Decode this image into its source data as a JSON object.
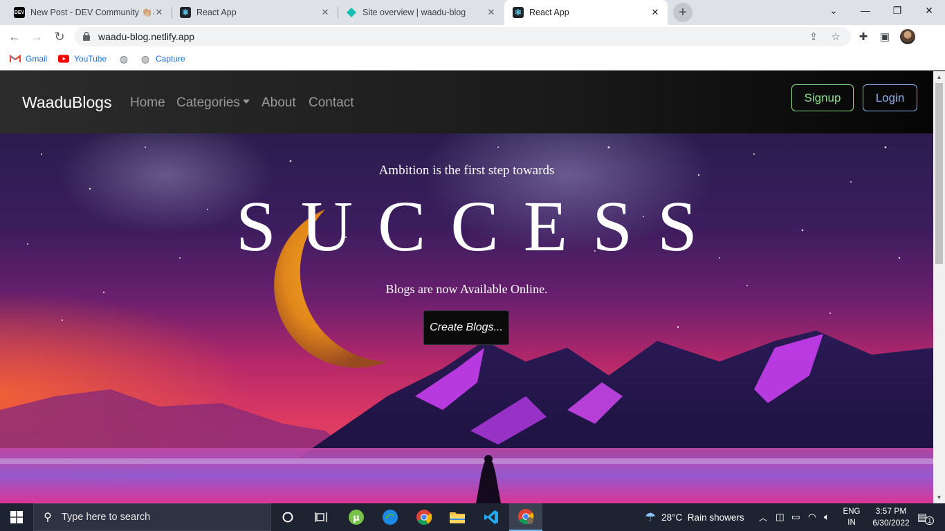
{
  "browser": {
    "tabs": [
      {
        "title": "New Post - DEV Community 👏🏼🧛",
        "favicon": "DEV",
        "active": false
      },
      {
        "title": "React App",
        "favicon": "react-icon",
        "active": false
      },
      {
        "title": "Site overview | waadu-blog",
        "favicon": "netlify-icon",
        "active": false
      },
      {
        "title": "React App",
        "favicon": "react-icon",
        "active": true
      }
    ],
    "url": "waadu-blog.netlify.app",
    "bookmarks": [
      {
        "label": "Gmail",
        "icon": "gmail-icon"
      },
      {
        "label": "YouTube",
        "icon": "youtube-icon"
      },
      {
        "label": "",
        "icon": "globe-icon"
      },
      {
        "label": "Capture",
        "icon": "globe-icon"
      }
    ]
  },
  "site": {
    "brand": "WaaduBlogs",
    "nav": {
      "home": "Home",
      "categories": "Categories",
      "about": "About",
      "contact": "Contact"
    },
    "signup": "Signup",
    "login": "Login",
    "colors": {
      "signup": "#8ee08e",
      "login": "#8fb5ea"
    }
  },
  "hero": {
    "tagline": "Ambition is the first step towards",
    "headline": "SUCCESS",
    "subline": "Blogs are now Available Online.",
    "cta": "Create Blogs..."
  },
  "taskbar": {
    "search_placeholder": "Type here to search",
    "weather": "28°C  Rain showers",
    "lang_top": "ENG",
    "lang_bottom": "IN",
    "time": "3:57 PM",
    "date": "6/30/2022",
    "notification_count": "1"
  }
}
